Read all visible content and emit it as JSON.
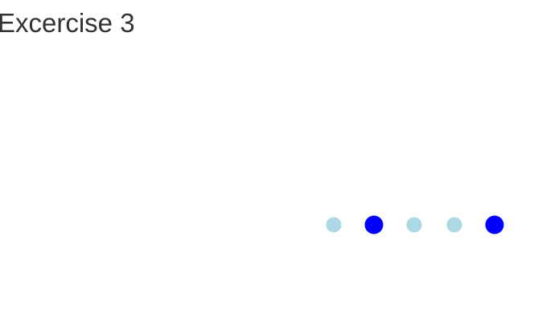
{
  "header": {
    "title": "Excercise 3"
  },
  "dots": [
    {
      "color": "#add8e6",
      "state": "small"
    },
    {
      "color": "#0000ff",
      "state": "large"
    },
    {
      "color": "#add8e6",
      "state": "small"
    },
    {
      "color": "#add8e6",
      "state": "small"
    },
    {
      "color": "#0000ff",
      "state": "large"
    }
  ]
}
